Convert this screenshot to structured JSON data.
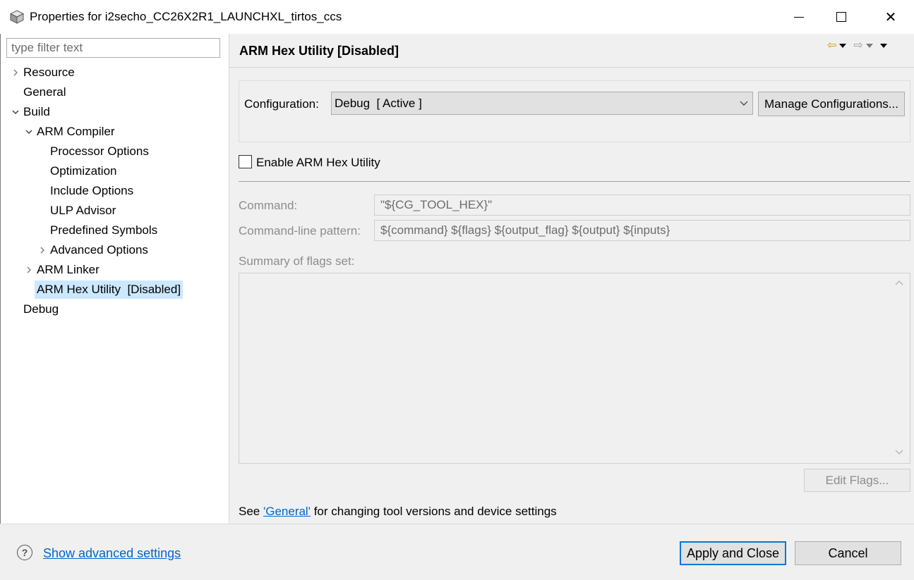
{
  "window": {
    "title": "Properties for i2secho_CC26X2R1_LAUNCHXL_tirtos_ccs",
    "app_icon": "properties-cube-icon",
    "minimize_icon": "minimize-icon",
    "maximize_icon": "maximize-icon",
    "close_icon": "close-icon",
    "close_glyph": "✕"
  },
  "filter": {
    "placeholder": "type filter text",
    "value": ""
  },
  "tree": [
    {
      "label": "Resource",
      "expander": "collapsed"
    },
    {
      "label": "General",
      "expander": "none"
    },
    {
      "label": "Build",
      "expander": "expanded"
    },
    {
      "label": "ARM Compiler",
      "expander": "expanded"
    },
    {
      "label": "Processor Options",
      "expander": "none"
    },
    {
      "label": "Optimization",
      "expander": "none"
    },
    {
      "label": "Include Options",
      "expander": "none"
    },
    {
      "label": "ULP Advisor",
      "expander": "none"
    },
    {
      "label": "Predefined Symbols",
      "expander": "none"
    },
    {
      "label": "Advanced Options",
      "expander": "collapsed"
    },
    {
      "label": "ARM Linker",
      "expander": "collapsed"
    },
    {
      "label": "ARM Hex Utility  [Disabled]",
      "expander": "none",
      "selected": true
    },
    {
      "label": "Debug",
      "expander": "none"
    }
  ],
  "page": {
    "title": "ARM Hex Utility  [Disabled]",
    "nav": {
      "back_icon": "back-arrow-icon",
      "forward_icon": "forward-arrow-icon",
      "back_glyph": "⇦",
      "forward_glyph": "⇨"
    }
  },
  "config": {
    "label": "Configuration:",
    "value": "Debug  [ Active ]",
    "chevron_glyph": "⌵",
    "manage_label": "Manage Configurations..."
  },
  "enable": {
    "label": "Enable ARM Hex Utility",
    "checked": false
  },
  "fields": {
    "command_label": "Command:",
    "command_value": "\"${CG_TOOL_HEX}\"",
    "pattern_label": "Command-line pattern:",
    "pattern_value": "${command} ${flags} ${output_flag} ${output} ${inputs}",
    "summary_label": "Summary of flags set:",
    "summary_value": "",
    "scroll_up_glyph": "▲",
    "scroll_down_glyph": "▼"
  },
  "edit_flags_label": "Edit Flags...",
  "see_line": {
    "prefix": "See ",
    "link": "'General'",
    "suffix": " for changing tool versions and device settings"
  },
  "bottom": {
    "help_glyph": "?",
    "show_advanced": "Show advanced settings",
    "apply_close": "Apply and Close",
    "cancel": "Cancel"
  },
  "colors": {
    "selection": "#cce8ff",
    "link": "#0066cc",
    "default_button_border": "#0078d7",
    "panel_bg": "#f0f0f0"
  }
}
